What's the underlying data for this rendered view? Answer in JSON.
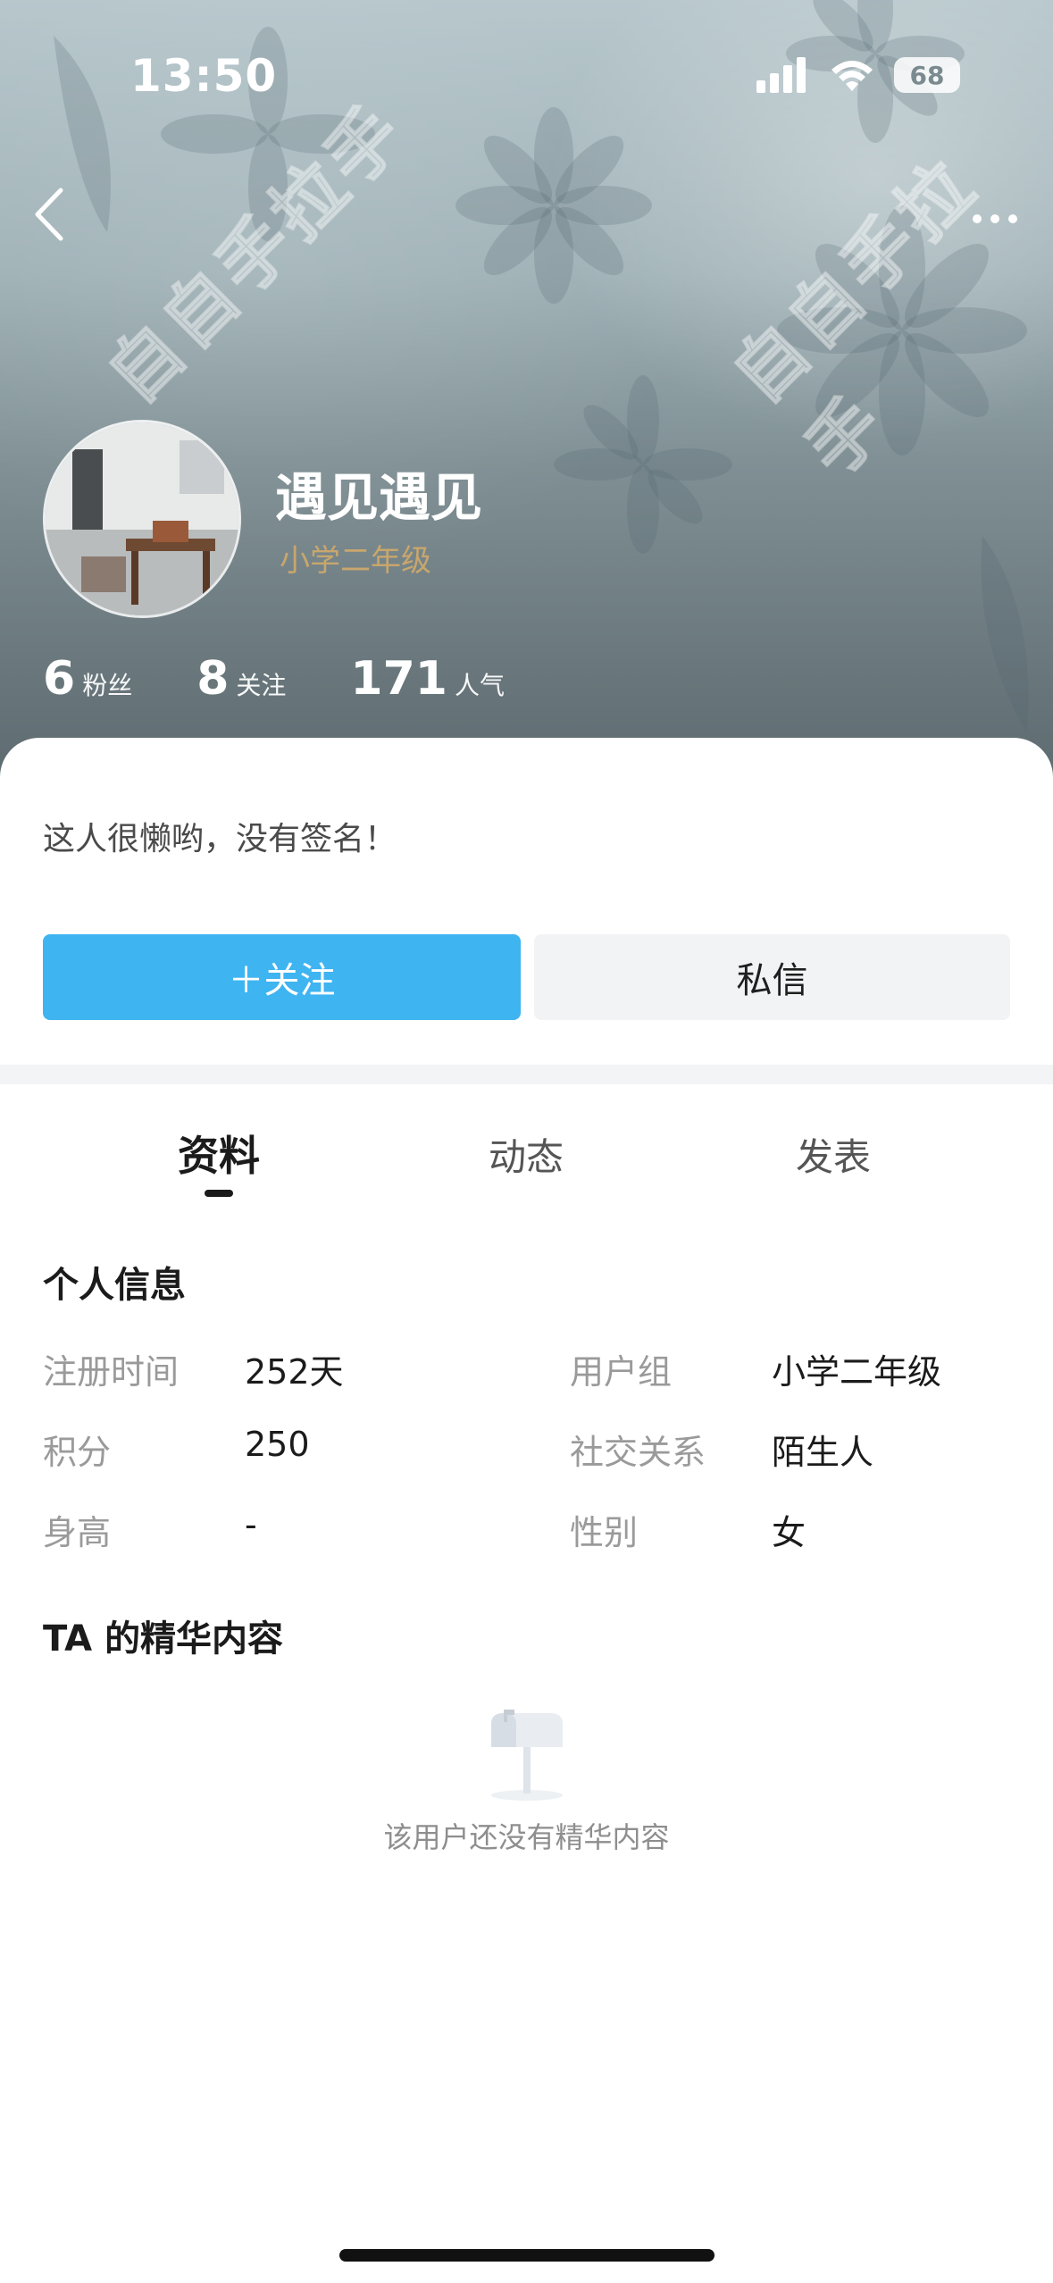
{
  "status_bar": {
    "time": "13:50",
    "battery": "68"
  },
  "header": {
    "watermark": "自自手拉手",
    "username": "遇见遇见",
    "usergroup": "小学二年级",
    "stats": [
      {
        "num": "6",
        "label": "粉丝"
      },
      {
        "num": "8",
        "label": "关注"
      },
      {
        "num": "171",
        "label": "人气"
      }
    ]
  },
  "profile": {
    "signature": "这人很懒哟，没有签名！",
    "follow_label": "＋关注",
    "message_label": "私信"
  },
  "tabs": [
    {
      "label": "资料",
      "active": true
    },
    {
      "label": "动态",
      "active": false
    },
    {
      "label": "发表",
      "active": false
    }
  ],
  "info": {
    "title": "个人信息",
    "rows": [
      {
        "k1": "注册时间",
        "v1": "252天",
        "k2": "用户组",
        "v2": "小学二年级"
      },
      {
        "k1": "积分",
        "v1": "250",
        "k2": "社交关系",
        "v2": "陌生人"
      },
      {
        "k1": "身高",
        "v1": "-",
        "k2": "性别",
        "v2": "女"
      }
    ]
  },
  "featured": {
    "title": "TA 的精华内容",
    "empty_text": "该用户还没有精华内容"
  }
}
